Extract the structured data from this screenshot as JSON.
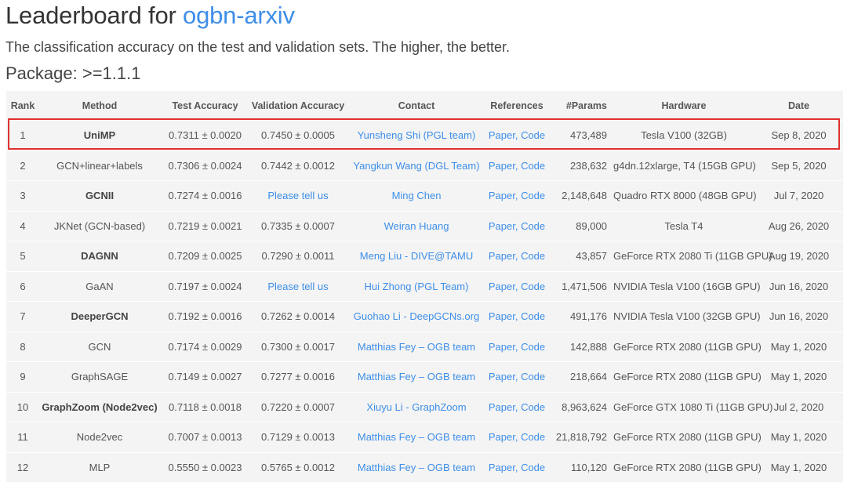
{
  "header": {
    "title_prefix": "Leaderboard for",
    "dataset_link": "ogbn-arxiv",
    "description": "The classification accuracy on the test and validation sets. The higher, the better.",
    "package": "Package: >=1.1.1"
  },
  "colors": {
    "link": "#3d8ee8",
    "highlight": "#e03030",
    "table_bg": "#f4f4f4"
  },
  "table": {
    "columns": [
      "Rank",
      "Method",
      "Test Accuracy",
      "Validation Accuracy",
      "Contact",
      "References",
      "#Params",
      "Hardware",
      "Date"
    ],
    "highlighted_rank": "1",
    "rows": [
      {
        "rank": "1",
        "method": "UniMP",
        "bold": true,
        "test": "0.7311 ± 0.0020",
        "val": "0.7450 ± 0.0005",
        "val_link": false,
        "contact": "Yunsheng Shi (PGL team)",
        "paper": "Paper",
        "code": "Code",
        "params": "473,489",
        "hardware": "Tesla V100 (32GB)",
        "date": "Sep 8, 2020"
      },
      {
        "rank": "2",
        "method": "GCN+linear+labels",
        "bold": false,
        "test": "0.7306 ± 0.0024",
        "val": "0.7442 ± 0.0012",
        "val_link": false,
        "contact": "Yangkun Wang (DGL Team)",
        "paper": "Paper",
        "code": "Code",
        "params": "238,632",
        "hardware": "g4dn.12xlarge, T4 (15GB GPU)",
        "date": "Sep 5, 2020"
      },
      {
        "rank": "3",
        "method": "GCNII",
        "bold": true,
        "test": "0.7274 ± 0.0016",
        "val": "Please tell us",
        "val_link": true,
        "contact": "Ming Chen",
        "paper": "Paper",
        "code": "Code",
        "params": "2,148,648",
        "hardware": "Quadro RTX 8000 (48GB GPU)",
        "date": "Jul 7, 2020"
      },
      {
        "rank": "4",
        "method": "JKNet (GCN-based)",
        "bold": false,
        "test": "0.7219 ± 0.0021",
        "val": "0.7335 ± 0.0007",
        "val_link": false,
        "contact": "Weiran Huang",
        "paper": "Paper",
        "code": "Code",
        "params": "89,000",
        "hardware": "Tesla T4",
        "date": "Aug 26, 2020"
      },
      {
        "rank": "5",
        "method": "DAGNN",
        "bold": true,
        "test": "0.7209 ± 0.0025",
        "val": "0.7290 ± 0.0011",
        "val_link": false,
        "contact": "Meng Liu - DIVE@TAMU",
        "paper": "Paper",
        "code": "Code",
        "params": "43,857",
        "hardware": "GeForce RTX 2080 Ti (11GB GPU)",
        "date": "Aug 19, 2020"
      },
      {
        "rank": "6",
        "method": "GaAN",
        "bold": false,
        "test": "0.7197 ± 0.0024",
        "val": "Please tell us",
        "val_link": true,
        "contact": "Hui Zhong (PGL Team)",
        "paper": "Paper",
        "code": "Code",
        "params": "1,471,506",
        "hardware": "NVIDIA Tesla V100 (16GB GPU)",
        "date": "Jun 16, 2020"
      },
      {
        "rank": "7",
        "method": "DeeperGCN",
        "bold": true,
        "test": "0.7192 ± 0.0016",
        "val": "0.7262 ± 0.0014",
        "val_link": false,
        "contact": "Guohao Li - DeepGCNs.org",
        "paper": "Paper",
        "code": "Code",
        "params": "491,176",
        "hardware": "NVIDIA Tesla V100 (32GB GPU)",
        "date": "Jun 16, 2020"
      },
      {
        "rank": "8",
        "method": "GCN",
        "bold": false,
        "test": "0.7174 ± 0.0029",
        "val": "0.7300 ± 0.0017",
        "val_link": false,
        "contact": "Matthias Fey – OGB team",
        "paper": "Paper",
        "code": "Code",
        "params": "142,888",
        "hardware": "GeForce RTX 2080 (11GB GPU)",
        "date": "May 1, 2020"
      },
      {
        "rank": "9",
        "method": "GraphSAGE",
        "bold": false,
        "test": "0.7149 ± 0.0027",
        "val": "0.7277 ± 0.0016",
        "val_link": false,
        "contact": "Matthias Fey – OGB team",
        "paper": "Paper",
        "code": "Code",
        "params": "218,664",
        "hardware": "GeForce RTX 2080 (11GB GPU)",
        "date": "May 1, 2020"
      },
      {
        "rank": "10",
        "method": "GraphZoom (Node2vec)",
        "bold": true,
        "test": "0.7118 ± 0.0018",
        "val": "0.7220 ± 0.0007",
        "val_link": false,
        "contact": "Xiuyu Li - GraphZoom",
        "paper": "Paper",
        "code": "Code",
        "params": "8,963,624",
        "hardware": "GeForce GTX 1080 Ti (11GB GPU)",
        "date": "Jul 2, 2020"
      },
      {
        "rank": "11",
        "method": "Node2vec",
        "bold": false,
        "test": "0.7007 ± 0.0013",
        "val": "0.7129 ± 0.0013",
        "val_link": false,
        "contact": "Matthias Fey – OGB team",
        "paper": "Paper",
        "code": "Code",
        "params": "21,818,792",
        "hardware": "GeForce RTX 2080 (11GB GPU)",
        "date": "May 1, 2020"
      },
      {
        "rank": "12",
        "method": "MLP",
        "bold": false,
        "test": "0.5550 ± 0.0023",
        "val": "0.5765 ± 0.0012",
        "val_link": false,
        "contact": "Matthias Fey – OGB team",
        "paper": "Paper",
        "code": "Code",
        "params": "110,120",
        "hardware": "GeForce RTX 2080 (11GB GPU)",
        "date": "May 1, 2020"
      }
    ]
  }
}
